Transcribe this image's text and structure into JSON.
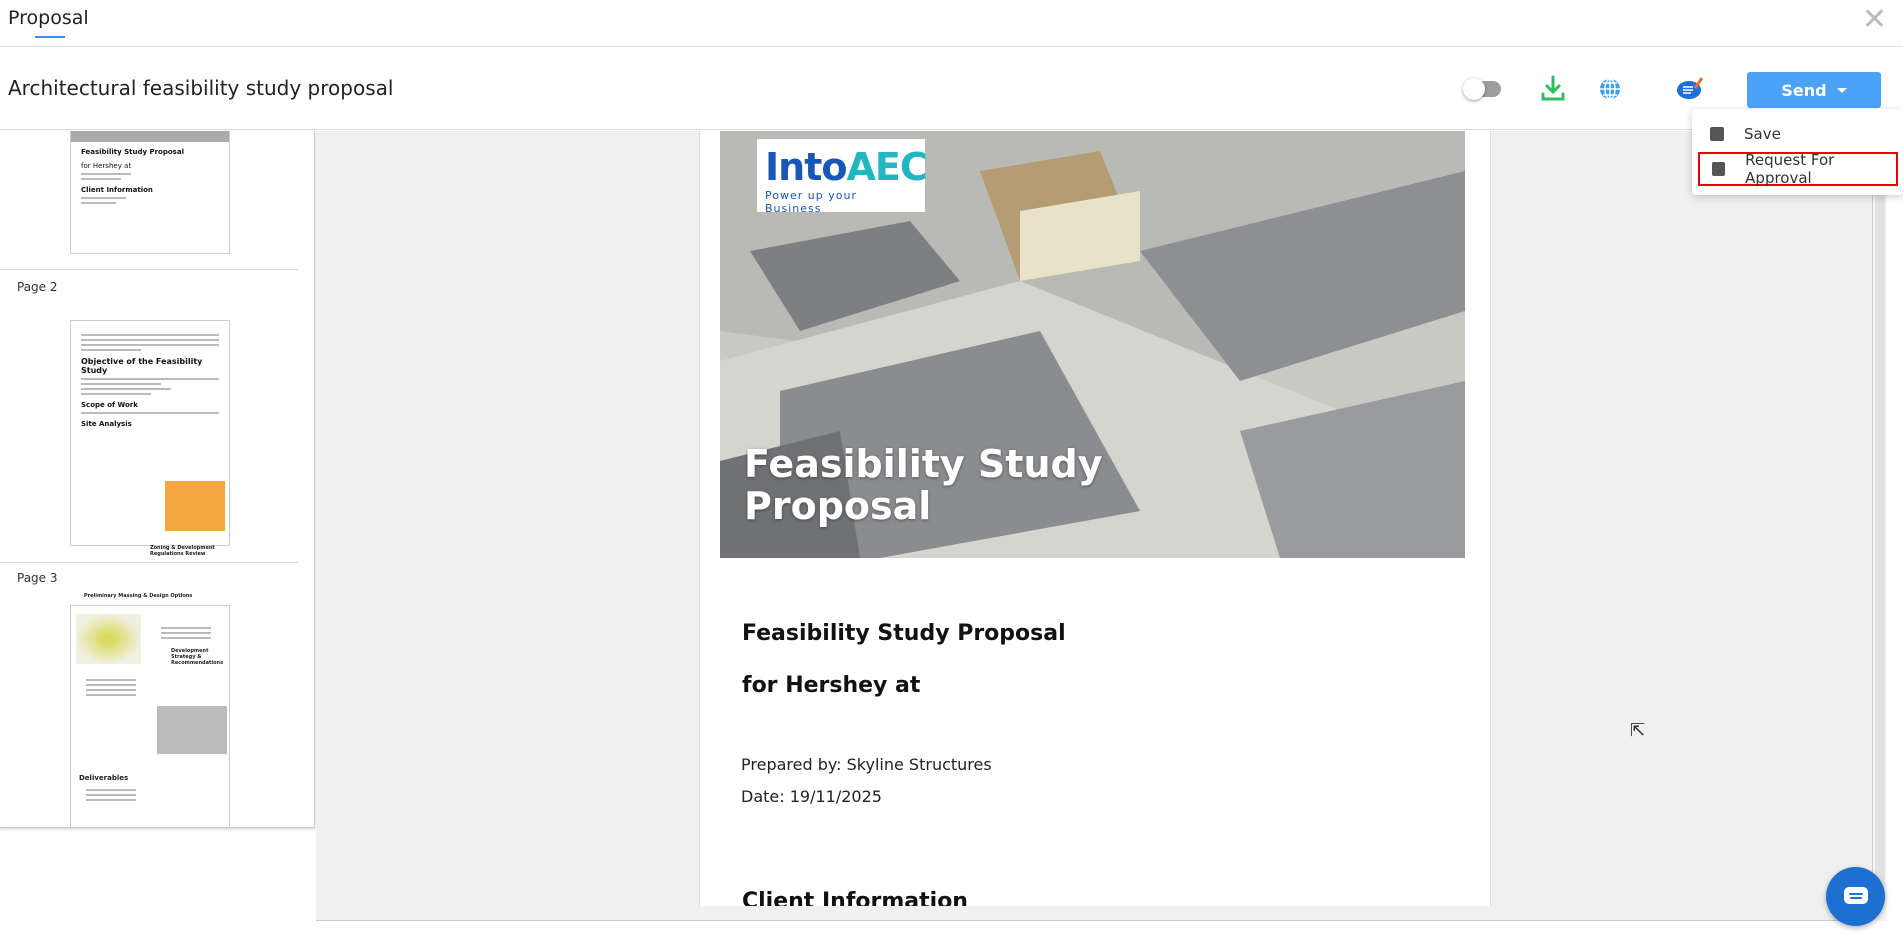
{
  "window": {
    "tab": "Proposal",
    "close_icon": "close-icon"
  },
  "header": {
    "title": "Architectural feasibility study proposal",
    "send_label": "Send",
    "icons": [
      "toggle-switch",
      "download-icon",
      "globe-icon",
      "chat-edit-icon"
    ],
    "accent": "#4aa3f7"
  },
  "send_menu": {
    "items": [
      {
        "label": "Save",
        "icon": "save-icon"
      },
      {
        "label": "Request For Approval",
        "icon": "approval-icon",
        "highlighted": true
      }
    ]
  },
  "thumbnails": {
    "page1": {
      "title": "Feasibility Study Proposal",
      "subtitle": "for Hershey at",
      "section": "Client Information"
    },
    "page2": {
      "label": "Page 2",
      "heading": "Objective of the Feasibility Study",
      "scope": "Scope of Work",
      "site": "Site Analysis",
      "zoning": "Zoning & Development Regulations Review"
    },
    "page3": {
      "label": "Page 3",
      "heading": "Preliminary Massing & Design Options",
      "dev": "Development Strategy & Recommendations",
      "deliverables": "Deliverables"
    }
  },
  "document": {
    "logo_text": "IntoAEC",
    "logo_tagline": "Power up your Business",
    "hero_title_1": "Feasibility Study",
    "hero_title_2": "Proposal",
    "title_1": "Feasibility Study Proposal",
    "title_2": "for Hershey at",
    "prepared_by": "Prepared by: Skyline Structures",
    "date": "Date: 19/11/2025",
    "section": "Client Information"
  }
}
